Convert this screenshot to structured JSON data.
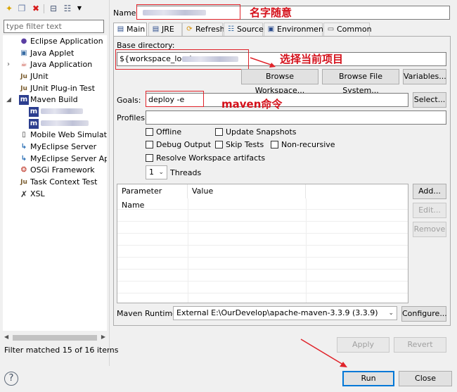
{
  "filter": {
    "placeholder": "type filter text"
  },
  "tree": [
    {
      "label": "Eclipse Application",
      "icon": "eclipse-icon"
    },
    {
      "label": "Java Applet",
      "icon": "java-applet-icon"
    },
    {
      "label": "Java Application",
      "icon": "java-application-icon"
    },
    {
      "label": "JUnit",
      "icon": "junit-icon"
    },
    {
      "label": "JUnit Plug-in Test",
      "icon": "junit-plugin-icon"
    },
    {
      "label": "Maven Build",
      "icon": "maven-icon"
    },
    {
      "label": "Mobile Web Simulato",
      "icon": "mobile-web-icon"
    },
    {
      "label": "MyEclipse Server",
      "icon": "myeclipse-server-icon"
    },
    {
      "label": "MyEclipse Server App",
      "icon": "myeclipse-server-app-icon"
    },
    {
      "label": "OSGi Framework",
      "icon": "osgi-icon"
    },
    {
      "label": "Task Context Test",
      "icon": "task-context-icon"
    },
    {
      "label": "XSL",
      "icon": "xsl-icon"
    }
  ],
  "filter_status": "Filter matched 15 of 16 items",
  "name": {
    "label": "Name:",
    "annotation": "名字随意"
  },
  "tabs": [
    {
      "label": "Main",
      "icon": "main-tab-icon"
    },
    {
      "label": "JRE",
      "icon": "jre-tab-icon"
    },
    {
      "label": "Refresh",
      "icon": "refresh-tab-icon"
    },
    {
      "label": "Source",
      "icon": "source-tab-icon"
    },
    {
      "label": "Environment",
      "icon": "environment-tab-icon"
    },
    {
      "label": "Common",
      "icon": "common-tab-icon"
    }
  ],
  "base_directory": {
    "label": "Base directory:",
    "value": "${workspace_loc:/",
    "annotation": "选择当前项目",
    "browse_workspace": "Browse Workspace...",
    "browse_file_system": "Browse File System...",
    "variables": "Variables..."
  },
  "goals": {
    "label": "Goals:",
    "value": "deploy -e",
    "select": "Select...",
    "annotation": "maven命令"
  },
  "profiles": {
    "label": "Profiles:"
  },
  "options": {
    "offline": "Offline",
    "update_snapshots": "Update Snapshots",
    "debug_output": "Debug Output",
    "skip_tests": "Skip Tests",
    "non_recursive": "Non-recursive",
    "resolve_workspace": "Resolve Workspace artifacts"
  },
  "threads": {
    "value": "1",
    "label": "Threads"
  },
  "parameters": {
    "columns": [
      "Parameter Name",
      "Value"
    ],
    "add": "Add...",
    "edit": "Edit...",
    "remove": "Remove"
  },
  "maven_runtime": {
    "label": "Maven Runtime:",
    "value": "External E:\\OurDevelop\\apache-maven-3.3.9 (3.3.9)",
    "configure": "Configure..."
  },
  "apply": "Apply",
  "revert": "Revert",
  "run": "Run",
  "close": "Close",
  "colors": {
    "annotation": "#e0232a",
    "default_button": "#0078d7"
  }
}
